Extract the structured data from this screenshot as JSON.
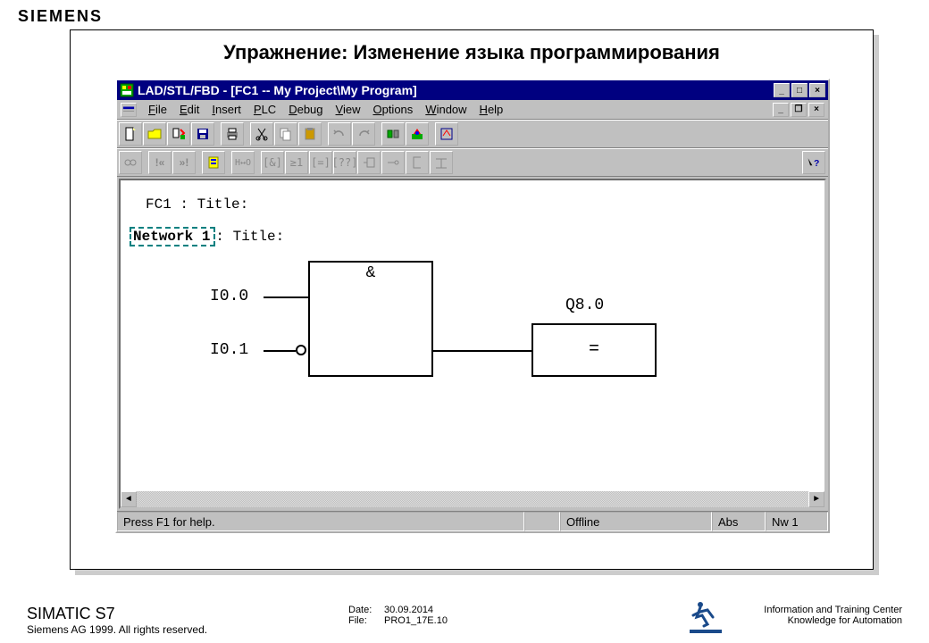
{
  "brand": "SIEMENS",
  "slide_title": "Упражнение: Изменение языка программирования",
  "window": {
    "title": "LAD/STL/FBD  - [FC1 -- My Project\\My Program]",
    "menu": [
      "File",
      "Edit",
      "Insert",
      "PLC",
      "Debug",
      "View",
      "Options",
      "Window",
      "Help"
    ]
  },
  "content": {
    "fc_line": "FC1 : Title:",
    "network_label": "Network 1",
    "network_suffix": ": Title:",
    "inputs": [
      "I0.0",
      "I0.1"
    ],
    "and_symbol": "&",
    "eq_symbol": "=",
    "output": "Q8.0"
  },
  "status": {
    "help": "Press F1 for help.",
    "mode": "Offline",
    "abs": "Abs",
    "nw": "Nw 1"
  },
  "footer": {
    "product": "SIMATIC S7",
    "copyright": "Siemens AG 1999. All rights reserved.",
    "date_label": "Date:",
    "date_value": "30.09.2014",
    "file_label": "File:",
    "file_value": "PRO1_17E.10",
    "org_line1": "Information and Training Center",
    "org_line2": "Knowledge for Automation"
  }
}
